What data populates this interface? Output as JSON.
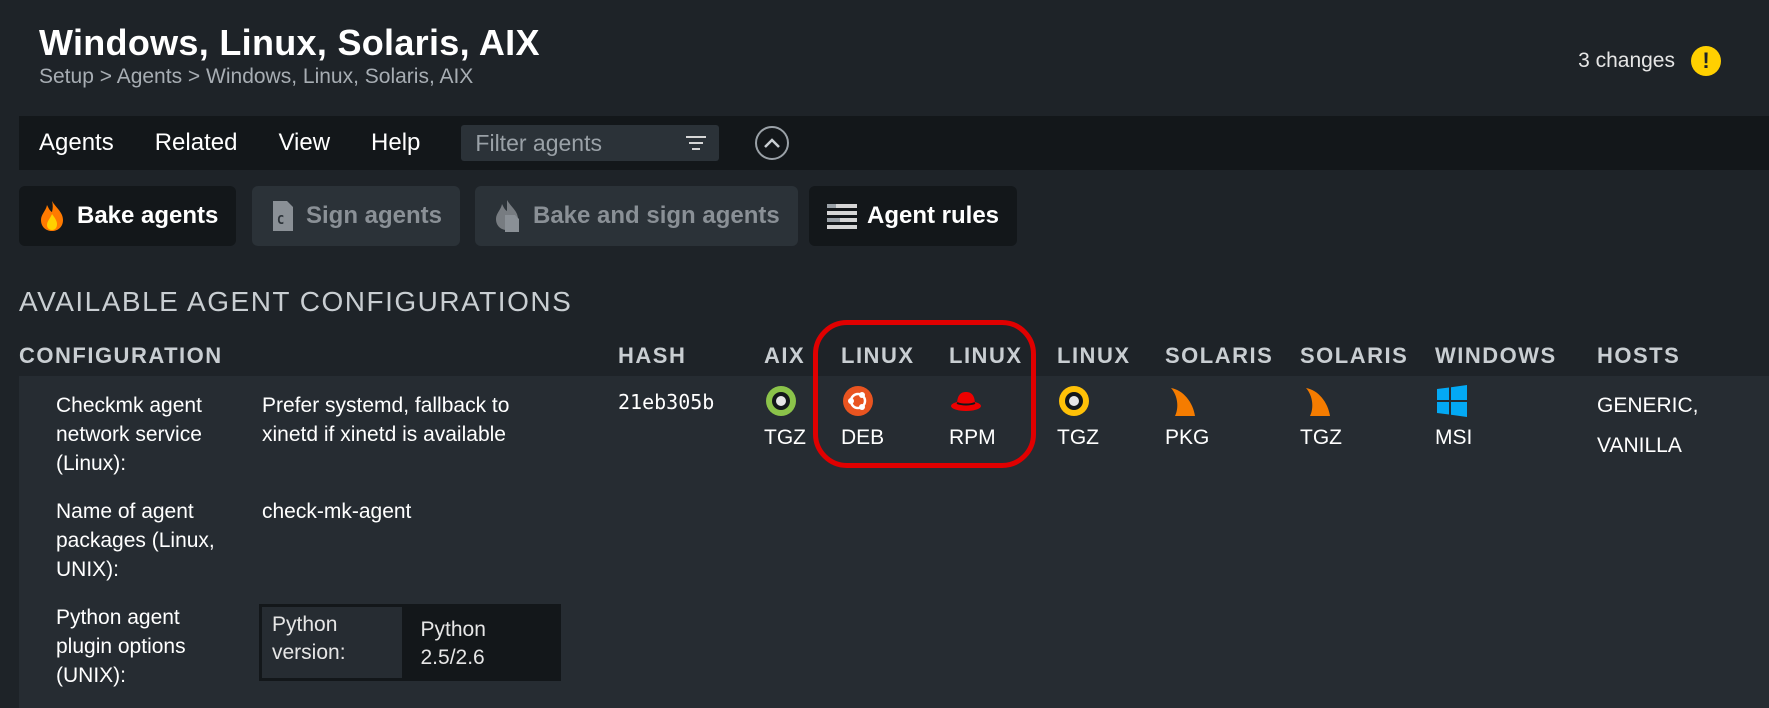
{
  "page": {
    "title": "Windows, Linux, Solaris, AIX",
    "breadcrumb": [
      "Setup",
      ">",
      "Agents",
      ">",
      "Windows, Linux, Solaris, AIX"
    ],
    "changes_label": "3 changes",
    "changes_icon": "!"
  },
  "menu": {
    "items": [
      "Agents",
      "Related",
      "View",
      "Help"
    ],
    "filter_placeholder": "Filter agents"
  },
  "actions": {
    "bake": "Bake agents",
    "sign": "Sign agents",
    "bake_sign": "Bake and sign agents",
    "rules": "Agent rules"
  },
  "section_title": "AVAILABLE AGENT CONFIGURATIONS",
  "table": {
    "headers": [
      "CONFIGURATION",
      "HASH",
      "AIX",
      "LINUX",
      "LINUX",
      "LINUX",
      "SOLARIS",
      "SOLARIS",
      "WINDOWS",
      "HOSTS"
    ],
    "row": {
      "settings": [
        {
          "name": "Checkmk agent network service (Linux):",
          "value": "Prefer systemd, fallback to xinetd if xinetd is available"
        },
        {
          "name": "Name of agent packages (Linux, UNIX):",
          "value": "check-mk-agent"
        },
        {
          "name": "Python agent plugin options (UNIX):",
          "nested_label": "Python version:",
          "nested_value": "Python 2.5/2.6"
        }
      ],
      "hash": "21eb305b",
      "packages": [
        {
          "os": "aix",
          "icon": "aix-icon",
          "label": "TGZ"
        },
        {
          "os": "linux-deb",
          "icon": "ubuntu-icon",
          "label": "DEB"
        },
        {
          "os": "linux-rpm",
          "icon": "redhat-icon",
          "label": "RPM"
        },
        {
          "os": "linux-tgz",
          "icon": "linux-tgz-icon",
          "label": "TGZ"
        },
        {
          "os": "solaris-pkg",
          "icon": "solaris-icon",
          "label": "PKG"
        },
        {
          "os": "solaris-tgz",
          "icon": "solaris-icon",
          "label": "TGZ"
        },
        {
          "os": "windows",
          "icon": "windows-icon",
          "label": "MSI"
        }
      ],
      "hosts": [
        "GENERIC,",
        "VANILLA"
      ]
    }
  },
  "colors": {
    "background": "#1e2328",
    "menubar": "#13171a",
    "row_bg": "#262c32",
    "highlight": "#e00000",
    "warning": "#ffd000"
  }
}
